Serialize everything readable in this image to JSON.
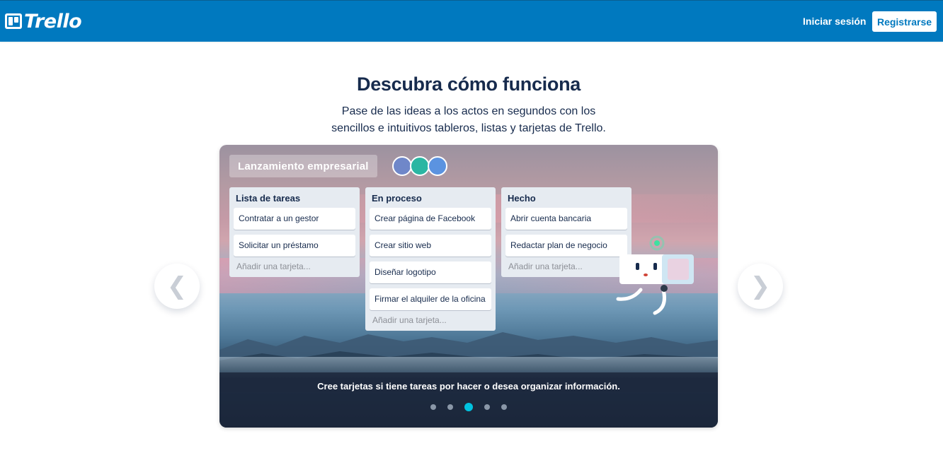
{
  "header": {
    "logo_text": "Trello",
    "login_label": "Iniciar sesión",
    "register_label": "Registrarse"
  },
  "hero": {
    "title": "Descubra cómo funciona",
    "subtitle_line1": "Pase de las ideas a los actos en segundos con los",
    "subtitle_line2": "sencillos e intuitivos tableros, listas y tarjetas de Trello."
  },
  "board": {
    "title": "Lanzamiento empresarial",
    "lists": [
      {
        "title": "Lista de tareas",
        "cards": [
          "Contratar a un gestor",
          "Solicitar un préstamo"
        ],
        "add_label": "Añadir una tarjeta..."
      },
      {
        "title": "En proceso",
        "cards": [
          "Crear página de Facebook",
          "Crear sitio web",
          "Diseñar logotipo",
          "Firmar el alquiler de la oficina"
        ],
        "add_label": "Añadir una tarjeta..."
      },
      {
        "title": "Hecho",
        "cards": [
          "Abrir cuenta bancaria",
          "Redactar plan de negocio"
        ],
        "add_label": "Añadir una tarjeta..."
      }
    ]
  },
  "carousel": {
    "caption": "Cree tarjetas si tiene tareas por hacer o desea organizar información.",
    "dot_count": 5,
    "active_dot": 3,
    "prev_icon": "chevron-left-icon",
    "next_icon": "chevron-right-icon"
  },
  "colors": {
    "brand_blue": "#0079bf",
    "active_dot": "#00c2e0",
    "heading": "#172b4d"
  }
}
